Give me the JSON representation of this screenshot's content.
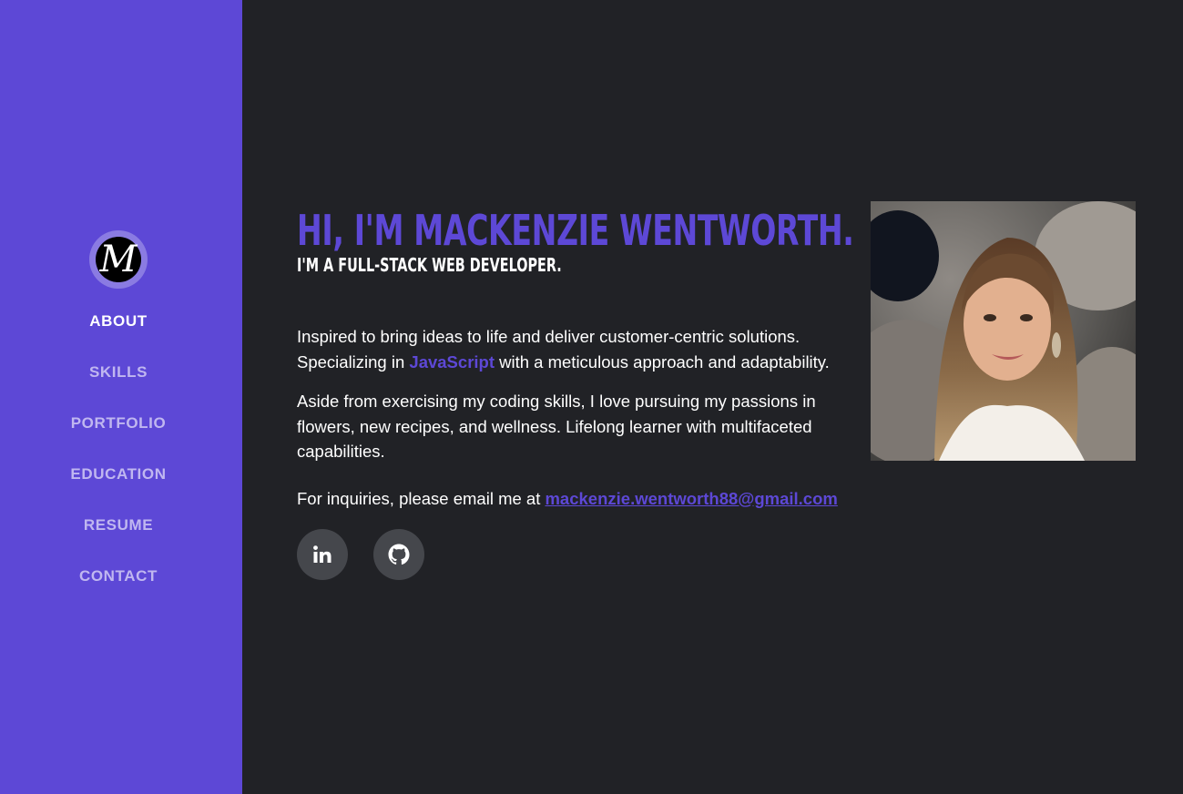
{
  "sidebar": {
    "logo": {
      "letter": "M",
      "icon": "monogram-logo-icon"
    },
    "nav": [
      {
        "label": "ABOUT",
        "active": true
      },
      {
        "label": "SKILLS",
        "active": false
      },
      {
        "label": "PORTFOLIO",
        "active": false
      },
      {
        "label": "EDUCATION",
        "active": false
      },
      {
        "label": "RESUME",
        "active": false
      },
      {
        "label": "CONTACT",
        "active": false
      }
    ],
    "background": "#5d48d6"
  },
  "main": {
    "headline": "HI, I'M MACKENZIE WENTWORTH.",
    "subhead": "I'M A FULL-STACK WEB DEVELOPER.",
    "intro": {
      "line_a": "Inspired to bring ideas to life and deliver customer-centric solutions. Specializing in ",
      "highlight": "JavaScript",
      "line_b": " with a meticulous approach and adaptability."
    },
    "bio": "Aside from exercising my coding skills, I love pursuing my passions in flowers, new recipes, and wellness. Lifelong learner with multifaceted capabilities.",
    "contact": {
      "prefix": "For inquiries, please email me at ",
      "email": "mackenzie.wentworth88@gmail.com"
    },
    "socials": [
      {
        "icon": "linkedin-icon"
      },
      {
        "icon": "github-icon"
      }
    ]
  },
  "colors": {
    "accent": "#5d48d6",
    "background": "#212226",
    "social_button": "#45474c"
  }
}
